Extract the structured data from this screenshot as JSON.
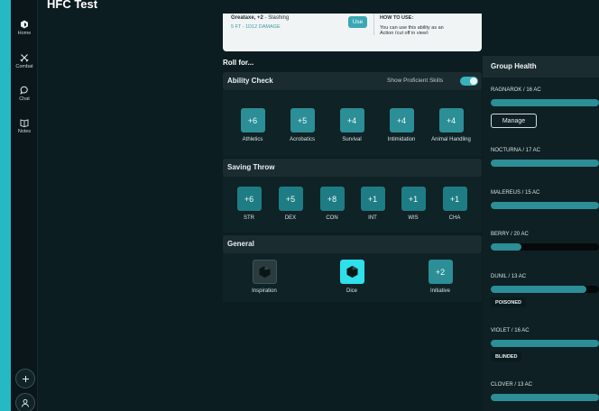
{
  "app": {
    "title": "HFC Test"
  },
  "sidebar": {
    "items": [
      {
        "label": "Home",
        "icon": "home-icon"
      },
      {
        "label": "Combat",
        "icon": "swords-icon"
      },
      {
        "label": "Chat",
        "icon": "chat-icon"
      },
      {
        "label": "Notes",
        "icon": "notes-icon"
      }
    ],
    "add_icon": "plus-icon",
    "profile_icon": "user-icon"
  },
  "ability_card": {
    "name": "Greataxe, +2",
    "damage_type": " - Slashing",
    "detail": "5 FT - 1D12 DAMAGE",
    "use_label": "Use",
    "how_to_use_title": "HOW TO USE:",
    "how_to_use_text": "You can use this ability as an",
    "how_to_use_text2": "Action (cut off in view)"
  },
  "roll_for": {
    "label": "Roll for..."
  },
  "ability_check": {
    "title": "Ability Check",
    "toggle_label": "Show Proficient Skills",
    "toggle_on": true,
    "skills": [
      {
        "value": "+6",
        "label": "Athletics"
      },
      {
        "value": "+5",
        "label": "Acrobatics"
      },
      {
        "value": "+4",
        "label": "Survival"
      },
      {
        "value": "+4",
        "label": "Intimidation"
      },
      {
        "value": "+4",
        "label": "Animal Handling"
      }
    ]
  },
  "saving_throw": {
    "title": "Saving Throw",
    "saves": [
      {
        "value": "+6",
        "label": "STR"
      },
      {
        "value": "+5",
        "label": "DEX"
      },
      {
        "value": "+8",
        "label": "CON"
      },
      {
        "value": "+1",
        "label": "INT"
      },
      {
        "value": "+1",
        "label": "WIS"
      },
      {
        "value": "+1",
        "label": "CHA"
      }
    ]
  },
  "general": {
    "title": "General",
    "items": [
      {
        "label": "Inspiration",
        "icon": "d20-icon"
      },
      {
        "label": "Dice",
        "icon": "d20-icon"
      },
      {
        "label": "Initiative",
        "value": "+2"
      }
    ]
  },
  "group_health": {
    "title": "Group Health",
    "manage_label": "Manage",
    "members": [
      {
        "name": "RAGNAROK / 16 AC",
        "hp_fraction": 1.0
      },
      {
        "name": "NOCTURNA / 17 AC",
        "hp_fraction": 1.0
      },
      {
        "name": "MALEREUS / 15 AC",
        "hp_fraction": 1.0
      },
      {
        "name": "BERRY / 20 AC",
        "hp_fraction": 0.28
      },
      {
        "name": "DUNIL / 13 AC",
        "hp_fraction": 0.88,
        "condition": "POISONED"
      },
      {
        "name": "VIOLET / 16 AC",
        "hp_fraction": 1.0,
        "condition": "BLINDED"
      },
      {
        "name": "CLOVER / 13 AC",
        "hp_fraction": 1.0
      }
    ]
  },
  "colors": {
    "accent": "#25b9c3",
    "button": "#2c8e96",
    "background": "#0c1d21"
  }
}
